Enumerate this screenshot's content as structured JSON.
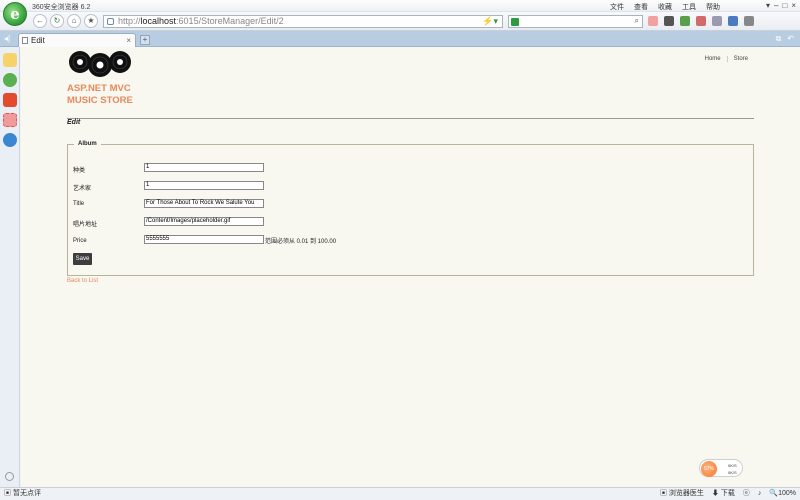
{
  "browser": {
    "app_title": "360安全浏览器 6.2",
    "logo_letter": "e",
    "menus": [
      "文件",
      "查看",
      "收藏",
      "工具",
      "帮助"
    ],
    "url_prefix": "http://",
    "url_host": "localhost",
    "url_path": ":6015/StoreManager/Edit/2",
    "search_value": "",
    "tab_title": "Edit",
    "new_tab_label": "+",
    "status_left": "暂无点评",
    "status_doctor": "浏览器医生",
    "status_download": "下载",
    "zoom": "100%",
    "speed_percent": "57%",
    "speed_up": "0K/S",
    "speed_down": "0K/S"
  },
  "store": {
    "brand_line1": "ASP.NET MVC",
    "brand_line2": "MUSIC STORE",
    "nav": [
      "Home",
      "Store"
    ],
    "accent_color": "#e58a5d"
  },
  "page": {
    "title": "Edit",
    "legend": "Album",
    "fields": [
      {
        "label": "种类",
        "value": "1"
      },
      {
        "label": "艺术家",
        "value": "1"
      },
      {
        "label": "Title",
        "value": "For Those About To Rock We Salute You"
      },
      {
        "label": "唱片地址",
        "value": "/Content/Images/placeholder.gif"
      },
      {
        "label": "Price",
        "value": "5555555",
        "error": "范围必须从 0.01 到 100.00"
      }
    ],
    "save_label": "Save",
    "back_link": "Back to List"
  }
}
